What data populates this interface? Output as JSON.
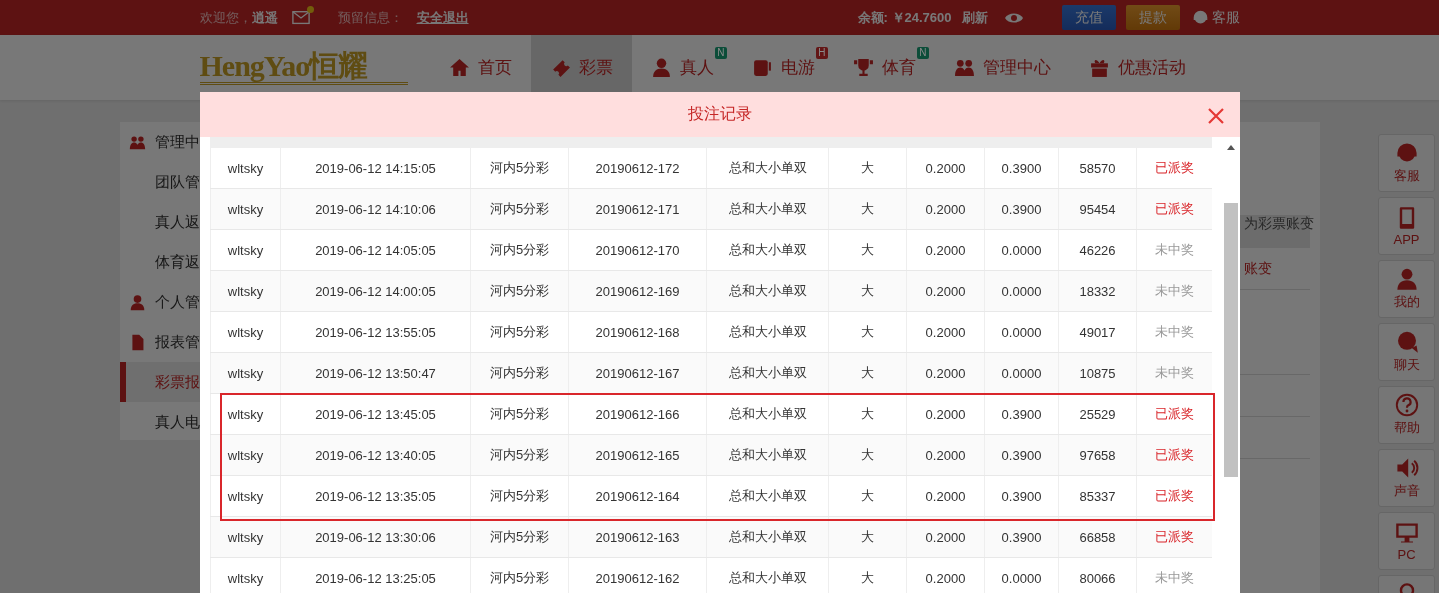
{
  "top_bar": {
    "welcome": "欢迎您，",
    "username": "逍遥",
    "mail_unread": true,
    "reserved_info": "预留信息：",
    "logout": "安全退出",
    "balance_label": "余额:",
    "balance": "￥24.7600",
    "refresh": "刷新",
    "deposit": "充值",
    "withdraw": "提款",
    "service": "客服"
  },
  "nav": {
    "logo": "HengYao恒耀",
    "items": [
      {
        "label": "首页",
        "selected": false
      },
      {
        "label": "彩票",
        "selected": true
      },
      {
        "label": "真人",
        "badge": "N",
        "color": "#0c4d39",
        "selected": false
      },
      {
        "label": "电游",
        "badge": "H",
        "color": "#631616",
        "selected": false
      },
      {
        "label": "体育",
        "badge": "N",
        "color": "#0c4d39",
        "selected": false
      },
      {
        "label": "管理中心",
        "selected": false
      },
      {
        "label": "优惠活动",
        "selected": false
      }
    ]
  },
  "sidebar": {
    "groups": [
      {
        "label": "管理中",
        "children": [
          {
            "label": "团队管",
            "selected": false
          },
          {
            "label": "真人返",
            "selected": false
          },
          {
            "label": "体育返",
            "selected": false
          }
        ]
      },
      {
        "label": "个人管"
      },
      {
        "label": "报表管",
        "children": [
          {
            "label": "彩票报",
            "selected": true
          },
          {
            "label": "真人电",
            "selected": false
          }
        ]
      }
    ]
  },
  "background_panel": {
    "note": "为彩票账变",
    "cell": "账变"
  },
  "float_bar": {
    "items": [
      {
        "kind": "labeled",
        "label": "客服"
      },
      {
        "kind": "labeled",
        "label": "APP"
      },
      {
        "kind": "labeled",
        "label": "我的"
      },
      {
        "kind": "labeled",
        "label": "聊天"
      },
      {
        "kind": "labeled",
        "label": "帮助"
      },
      {
        "kind": "labeled",
        "label": "声音"
      },
      {
        "kind": "labeled",
        "label": "PC"
      },
      {
        "kind": "icon_only"
      }
    ]
  },
  "modal": {
    "title": "投注记录",
    "rows": [
      {
        "cells": [
          "wltsky",
          "2019-06-12 14:15:05",
          "河内5分彩",
          "20190612-172",
          "总和大小单双",
          "大",
          "0.2000",
          "0.3900",
          "58570",
          "已派奖"
        ],
        "won": true,
        "highlighted": false
      },
      {
        "cells": [
          "wltsky",
          "2019-06-12 14:10:06",
          "河内5分彩",
          "20190612-171",
          "总和大小单双",
          "大",
          "0.2000",
          "0.3900",
          "95454",
          "已派奖"
        ],
        "won": true,
        "highlighted": false
      },
      {
        "cells": [
          "wltsky",
          "2019-06-12 14:05:05",
          "河内5分彩",
          "20190612-170",
          "总和大小单双",
          "大",
          "0.2000",
          "0.0000",
          "46226",
          "未中奖"
        ],
        "won": false,
        "highlighted": false
      },
      {
        "cells": [
          "wltsky",
          "2019-06-12 14:00:05",
          "河内5分彩",
          "20190612-169",
          "总和大小单双",
          "大",
          "0.2000",
          "0.0000",
          "18332",
          "未中奖"
        ],
        "won": false,
        "highlighted": false
      },
      {
        "cells": [
          "wltsky",
          "2019-06-12 13:55:05",
          "河内5分彩",
          "20190612-168",
          "总和大小单双",
          "大",
          "0.2000",
          "0.0000",
          "49017",
          "未中奖"
        ],
        "won": false,
        "highlighted": false
      },
      {
        "cells": [
          "wltsky",
          "2019-06-12 13:50:47",
          "河内5分彩",
          "20190612-167",
          "总和大小单双",
          "大",
          "0.2000",
          "0.0000",
          "10875",
          "未中奖"
        ],
        "won": false,
        "highlighted": false
      },
      {
        "cells": [
          "wltsky",
          "2019-06-12 13:45:05",
          "河内5分彩",
          "20190612-166",
          "总和大小单双",
          "大",
          "0.2000",
          "0.3900",
          "25529",
          "已派奖"
        ],
        "won": true,
        "highlighted": true
      },
      {
        "cells": [
          "wltsky",
          "2019-06-12 13:40:05",
          "河内5分彩",
          "20190612-165",
          "总和大小单双",
          "大",
          "0.2000",
          "0.3900",
          "97658",
          "已派奖"
        ],
        "won": true,
        "highlighted": true
      },
      {
        "cells": [
          "wltsky",
          "2019-06-12 13:35:05",
          "河内5分彩",
          "20190612-164",
          "总和大小单双",
          "大",
          "0.2000",
          "0.3900",
          "85337",
          "已派奖"
        ],
        "won": true,
        "highlighted": true
      },
      {
        "cells": [
          "wltsky",
          "2019-06-12 13:30:06",
          "河内5分彩",
          "20190612-163",
          "总和大小单双",
          "大",
          "0.2000",
          "0.3900",
          "66858",
          "已派奖"
        ],
        "won": true,
        "highlighted": false
      },
      {
        "cells": [
          "wltsky",
          "2019-06-12 13:25:05",
          "河内5分彩",
          "20190612-162",
          "总和大小单双",
          "大",
          "0.2000",
          "0.0000",
          "80066",
          "未中奖"
        ],
        "won": false,
        "highlighted": false
      }
    ]
  }
}
